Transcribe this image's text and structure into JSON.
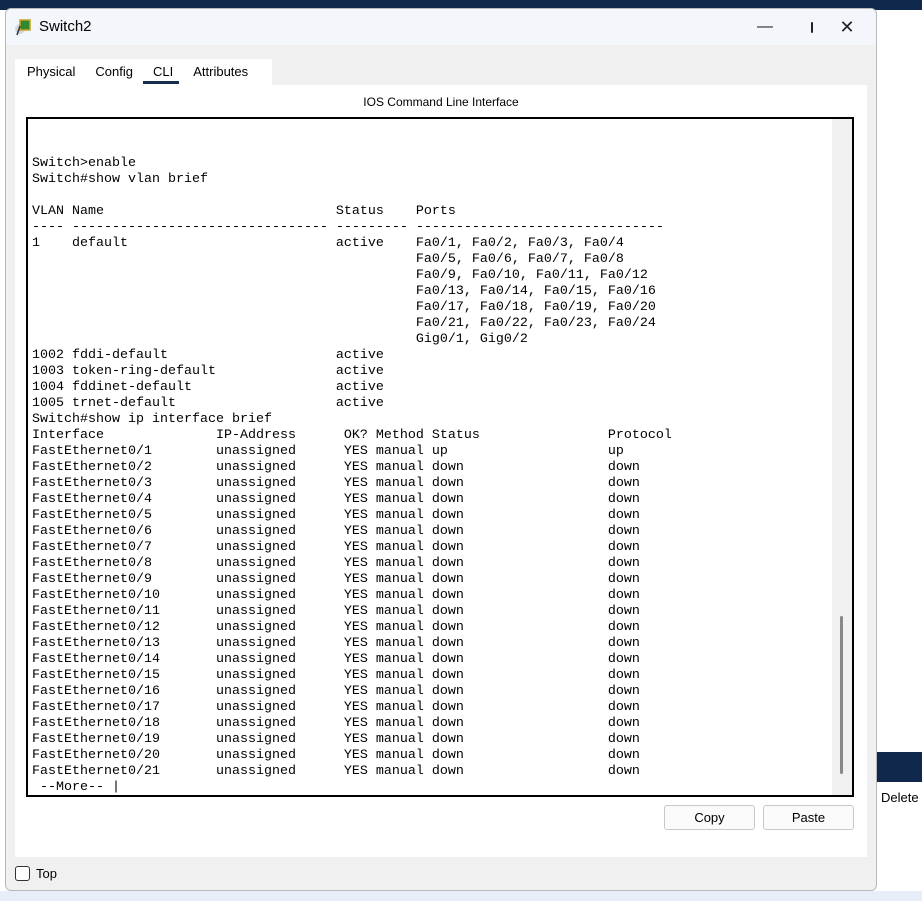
{
  "window": {
    "title": "Switch2"
  },
  "tabs": [
    {
      "label": "Physical"
    },
    {
      "label": "Config"
    },
    {
      "label": "CLI",
      "active": true
    },
    {
      "label": "Attributes"
    }
  ],
  "cli": {
    "heading": "IOS Command Line Interface",
    "lines": [
      "",
      "",
      "",
      "Switch>enable",
      "Switch#show vlan brief",
      "",
      "VLAN Name                             Status    Ports",
      "---- -------------------------------- --------- -------------------------------",
      "1    default                          active    Fa0/1, Fa0/2, Fa0/3, Fa0/4",
      "                                                Fa0/5, Fa0/6, Fa0/7, Fa0/8",
      "                                                Fa0/9, Fa0/10, Fa0/11, Fa0/12",
      "                                                Fa0/13, Fa0/14, Fa0/15, Fa0/16",
      "                                                Fa0/17, Fa0/18, Fa0/19, Fa0/20",
      "                                                Fa0/21, Fa0/22, Fa0/23, Fa0/24",
      "                                                Gig0/1, Gig0/2",
      "1002 fddi-default                     active",
      "1003 token-ring-default               active",
      "1004 fddinet-default                  active",
      "1005 trnet-default                    active",
      "Switch#show ip interface brief",
      "Interface              IP-Address      OK? Method Status                Protocol",
      "FastEthernet0/1        unassigned      YES manual up                    up",
      "FastEthernet0/2        unassigned      YES manual down                  down",
      "FastEthernet0/3        unassigned      YES manual down                  down",
      "FastEthernet0/4        unassigned      YES manual down                  down",
      "FastEthernet0/5        unassigned      YES manual down                  down",
      "FastEthernet0/6        unassigned      YES manual down                  down",
      "FastEthernet0/7        unassigned      YES manual down                  down",
      "FastEthernet0/8        unassigned      YES manual down                  down",
      "FastEthernet0/9        unassigned      YES manual down                  down",
      "FastEthernet0/10       unassigned      YES manual down                  down",
      "FastEthernet0/11       unassigned      YES manual down                  down",
      "FastEthernet0/12       unassigned      YES manual down                  down",
      "FastEthernet0/13       unassigned      YES manual down                  down",
      "FastEthernet0/14       unassigned      YES manual down                  down",
      "FastEthernet0/15       unassigned      YES manual down                  down",
      "FastEthernet0/16       unassigned      YES manual down                  down",
      "FastEthernet0/17       unassigned      YES manual down                  down",
      "FastEthernet0/18       unassigned      YES manual down                  down",
      "FastEthernet0/19       unassigned      YES manual down                  down",
      "FastEthernet0/20       unassigned      YES manual down                  down",
      "FastEthernet0/21       unassigned      YES manual down                  down",
      " --More-- |"
    ]
  },
  "buttons": {
    "copy": "Copy",
    "paste": "Paste"
  },
  "top_checkbox": {
    "label": "Top",
    "checked": false
  },
  "background": {
    "delete_label": "Delete"
  },
  "colors": {
    "titlebar": "#f3f6fb",
    "tab_underline": "#14304e",
    "desktop": "#10284b"
  }
}
